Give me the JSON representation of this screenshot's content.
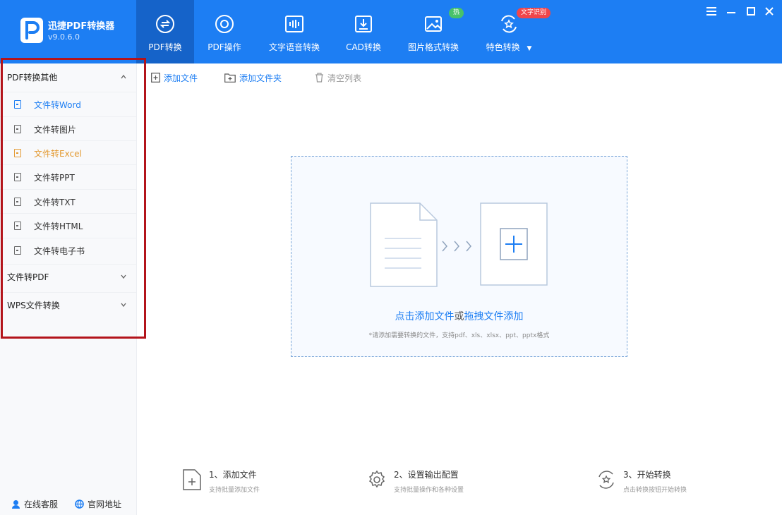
{
  "app": {
    "name": "迅捷PDF转换器",
    "version": "v9.0.6.0"
  },
  "nav": {
    "tabs": [
      {
        "label": "PDF转换",
        "icon": "pdf-convert-icon",
        "active": true
      },
      {
        "label": "PDF操作",
        "icon": "pdf-operate-icon"
      },
      {
        "label": "文字语音转换",
        "icon": "text-voice-icon"
      },
      {
        "label": "CAD转换",
        "icon": "cad-convert-icon"
      },
      {
        "label": "图片格式转换",
        "icon": "image-convert-icon"
      },
      {
        "label": "特色转换",
        "icon": "feature-convert-icon"
      }
    ],
    "image_badge": "热",
    "feature_badge": "文字识别"
  },
  "sidebar": {
    "group_pdf_to_other": "PDF转换其他",
    "items": [
      {
        "label": "文件转Word",
        "icon": "word-file-icon"
      },
      {
        "label": "文件转图片",
        "icon": "image-file-icon"
      },
      {
        "label": "文件转Excel",
        "icon": "excel-file-icon"
      },
      {
        "label": "文件转PPT",
        "icon": "ppt-file-icon"
      },
      {
        "label": "文件转TXT",
        "icon": "txt-file-icon"
      },
      {
        "label": "文件转HTML",
        "icon": "html-file-icon"
      },
      {
        "label": "文件转电子书",
        "icon": "ebook-file-icon"
      }
    ],
    "group_file_to_pdf": "文件转PDF",
    "group_wps": "WPS文件转换",
    "footer_service": "在线客服",
    "footer_site": "官网地址"
  },
  "toolbar": {
    "add_file": "添加文件",
    "add_folder": "添加文件夹",
    "clear_list": "清空列表"
  },
  "dropzone": {
    "action_click": "点击添加文件",
    "action_or": "或",
    "action_drag": "拖拽文件添加",
    "hint": "*请添加需要转换的文件，支持pdf、xls、xlsx、ppt、pptx格式"
  },
  "steps": [
    {
      "title": "1、添加文件",
      "desc": "支持批量添加文件"
    },
    {
      "title": "2、设置输出配置",
      "desc": "支持批量操作和各种设置"
    },
    {
      "title": "3、开始转换",
      "desc": "点击转换按钮开始转换"
    }
  ],
  "colors": {
    "primary": "#1d7ef3",
    "active_tab": "#1563c9",
    "highlight_box": "#b3141b",
    "warning_text": "#e39a32"
  }
}
